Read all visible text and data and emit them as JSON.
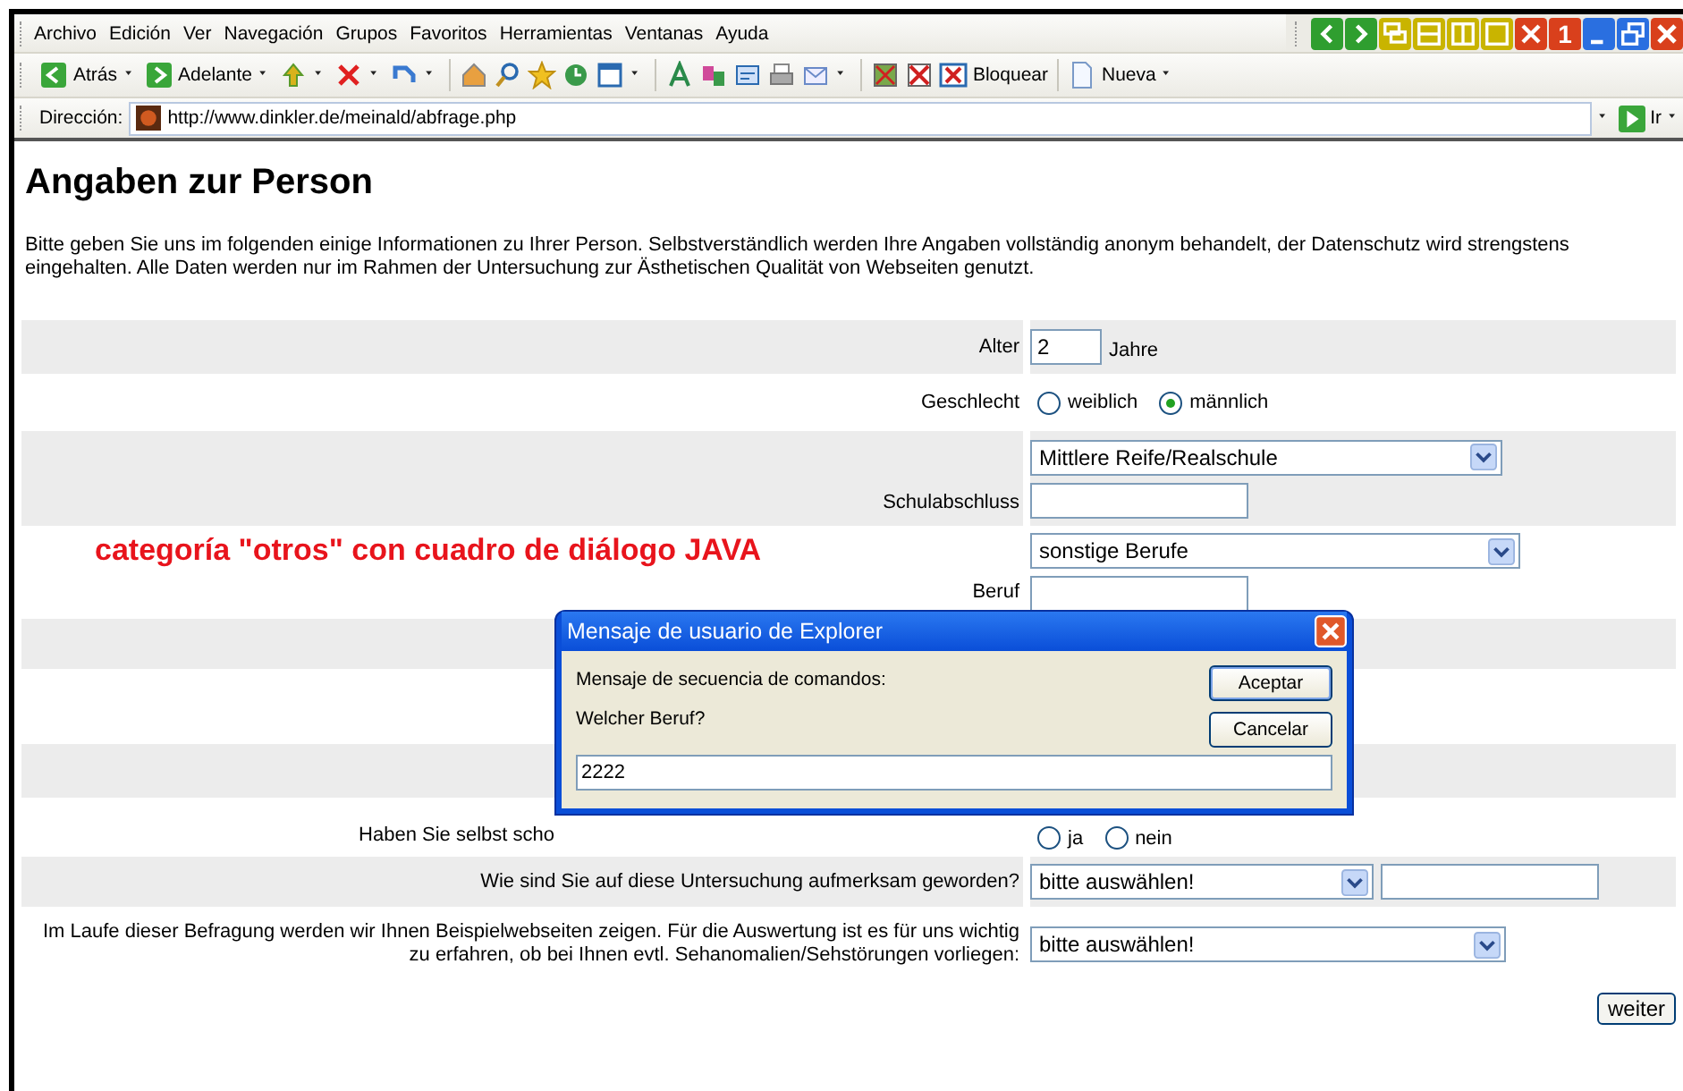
{
  "menu": [
    "Archivo",
    "Edición",
    "Ver",
    "Navegación",
    "Grupos",
    "Favoritos",
    "Herramientas",
    "Ventanas",
    "Ayuda"
  ],
  "window_buttons": [
    {
      "kind": "back"
    },
    {
      "kind": "forward"
    },
    {
      "kind": "cascade"
    },
    {
      "kind": "tile_h"
    },
    {
      "kind": "tile_v"
    },
    {
      "kind": "maximize_tab"
    },
    {
      "kind": "close_all"
    },
    {
      "kind": "number",
      "label": "1"
    },
    {
      "kind": "minimize"
    },
    {
      "kind": "restore"
    },
    {
      "kind": "close"
    }
  ],
  "toolbar": [
    {
      "kind": "back",
      "label": "Atrás",
      "dropdown": true
    },
    {
      "kind": "forward",
      "label": "Adelante",
      "dropdown": true
    },
    {
      "kind": "up",
      "dropdown": true
    },
    {
      "kind": "stop",
      "dropdown": true
    },
    {
      "kind": "refresh",
      "dropdown": true
    },
    {
      "kind": "home"
    },
    {
      "kind": "search"
    },
    {
      "kind": "star"
    },
    {
      "kind": "history"
    },
    {
      "kind": "window",
      "dropdown": true
    },
    {
      "kind": "font"
    },
    {
      "kind": "translate"
    },
    {
      "kind": "form"
    },
    {
      "kind": "print"
    },
    {
      "kind": "mail",
      "dropdown": true
    },
    {
      "kind": "image"
    },
    {
      "kind": "noscript"
    },
    {
      "kind": "block",
      "label": "Bloquear"
    },
    {
      "kind": "page",
      "label": "Nueva",
      "dropdown": true
    }
  ],
  "address": {
    "label": "Dirección:",
    "url": "http://www.dinkler.de/meinald/abfrage.php",
    "go": "Ir"
  },
  "page": {
    "title": "Angaben zur Person",
    "intro": "Bitte geben Sie uns im folgenden einige Informationen zu Ihrer Person. Selbstverständlich werden Ihre Angaben vollständig anonym behandelt, der Datenschutz wird strengstens eingehalten. Alle Daten werden nur im Rahmen der Untersuchung zur Ästhetischen Qualität von Webseiten genutzt.",
    "rows": [
      {
        "kind": "number",
        "label": "Alter",
        "value": "2",
        "suffix": "Jahre"
      },
      {
        "kind": "radio",
        "label": "Geschlecht",
        "options": [
          {
            "label": "weiblich",
            "selected": false
          },
          {
            "label": "männlich",
            "selected": true
          }
        ]
      },
      {
        "kind": "select_text",
        "label": "Schulabschluss",
        "value": "Mittlere Reife/Realschule"
      },
      {
        "kind": "select_text",
        "label": "Beruf",
        "value": "sonstige Berufe"
      },
      {
        "kind": "empty"
      },
      {
        "kind": "empty"
      },
      {
        "kind": "empty"
      },
      {
        "kind": "radio",
        "label": "Haben Sie selbst scho",
        "options": [
          {
            "label": "ja",
            "selected": false
          },
          {
            "label": "nein",
            "selected": false
          }
        ]
      },
      {
        "kind": "select_field",
        "label": "Wie sind Sie auf diese Untersuchung aufmerksam geworden?",
        "value": "bitte auswählen!"
      },
      {
        "kind": "select",
        "label": "Im Laufe dieser Befragung werden wir Ihnen Beispielwebseiten zeigen. Für die Auswertung ist es für uns wichtig zu erfahren, ob bei Ihnen evtl. Sehanomalien/Sehstörungen vorliegen:",
        "value": "bitte auswählen!"
      }
    ],
    "submit": "weiter",
    "annotation": "categoría \"otros\" con cuadro de diálogo JAVA"
  },
  "dialog": {
    "title": "Mensaje de usuario de Explorer",
    "message": "Mensaje de secuencia de comandos:",
    "prompt": "Welcher Beruf?",
    "value": "2222",
    "buttons": [
      "Aceptar",
      "Cancelar"
    ]
  }
}
